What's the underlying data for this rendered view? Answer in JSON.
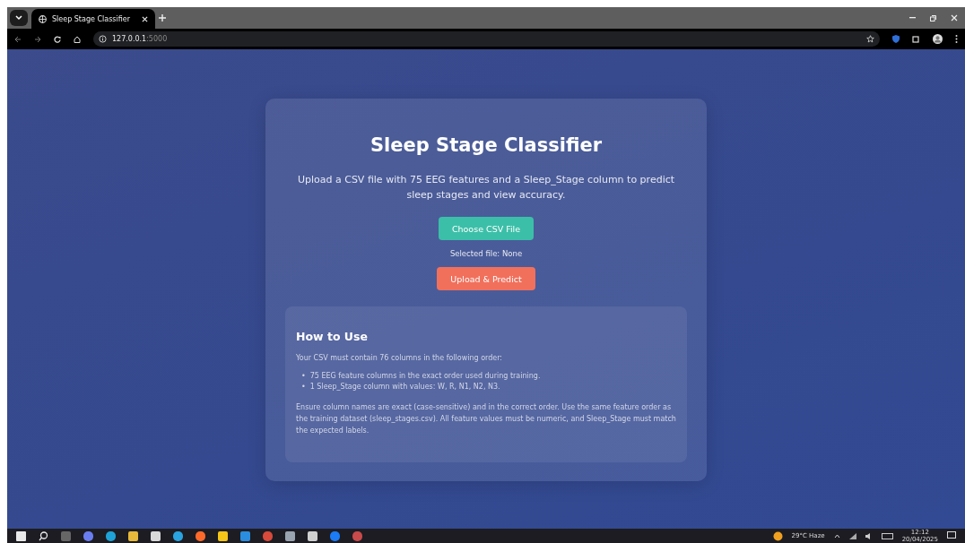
{
  "browser": {
    "tabs": [
      {
        "title": "Sleep Stage Classifier",
        "selected": true
      }
    ],
    "url_host": "127.0.0.1",
    "url_port": ":5000"
  },
  "card": {
    "title": "Sleep Stage Classifier",
    "subtitle": "Upload a CSV file with 75 EEG features and a Sleep_Stage column to predict sleep stages and view accuracy.",
    "choose_button": "Choose CSV File",
    "selected_file": "Selected file: None",
    "upload_button": "Upload & Predict"
  },
  "how_to": {
    "title": "How to Use",
    "intro": "Your CSV must contain 76 columns in the following order:",
    "bullets": [
      {
        "marker": "•",
        "text": "75 EEG feature columns in the exact order used during training."
      },
      {
        "marker": "•",
        "text": "1 Sleep_Stage column with values: W, R, N1, N2, N3."
      }
    ],
    "note": "Ensure column names are exact (case-sensitive) and in the correct order. Use the same feature order as the training dataset (sleep_stages.csv). All feature values must be numeric, and Sleep_Stage must match the expected labels."
  },
  "taskbar": {
    "weather": "29°C  Haze",
    "time": "12:12",
    "date": "20/04/2025"
  }
}
